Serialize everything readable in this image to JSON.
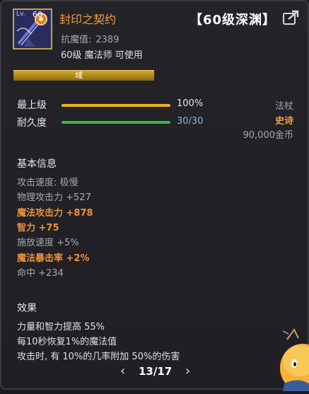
{
  "item": {
    "level_prefix": "Lv.",
    "level": "60",
    "name": "封印之契约",
    "grade_tag": "【60级深渊】",
    "anti_magic_label": "抗魔值:",
    "anti_magic_value": "2389",
    "requirement": "60级 魔法师 可使用"
  },
  "domain": {
    "label": "域"
  },
  "stats": {
    "max_level_label": "最上级",
    "max_level_value": "100%",
    "max_level_fraction": 1.0,
    "durability_label": "耐久度",
    "durability_value": "30/30",
    "durability_fraction": 1.0
  },
  "side_info": {
    "type": "法杖",
    "rarity": "史诗",
    "price": "90,000金币"
  },
  "basic_info": {
    "title": "基本信息",
    "lines": [
      {
        "text": "攻击速度: 极慢",
        "highlight": false
      },
      {
        "text": "物理攻击力 +527",
        "highlight": false
      },
      {
        "text": "魔法攻击力 +878",
        "highlight": true
      },
      {
        "text": "智力 +75",
        "highlight": true
      },
      {
        "text": "施放速度 +5%",
        "highlight": false
      },
      {
        "text": "魔法暴击率 +2%",
        "highlight": true
      },
      {
        "text": "命中 +234",
        "highlight": false
      }
    ]
  },
  "effects": {
    "title": "效果",
    "lines": [
      "力量和智力提高 55%",
      "每10秒恢复1%的魔法值",
      "攻击时, 有 10%的几率附加 50%的伤害"
    ]
  },
  "pager": {
    "prev_symbol": "‹",
    "next_symbol": "›",
    "text": "13/17"
  },
  "colors": {
    "item_name": "#f0a040",
    "highlight_attr": "#f0903a",
    "max_level_bar": "#f0b020",
    "durability_bar": "#3ab840",
    "rarity": "#f0a040",
    "domain_bar": "#c79a20"
  },
  "icons": {
    "item": "magic-staff-icon",
    "share": "share-arrow-icon",
    "mascot": "mascot-character"
  }
}
